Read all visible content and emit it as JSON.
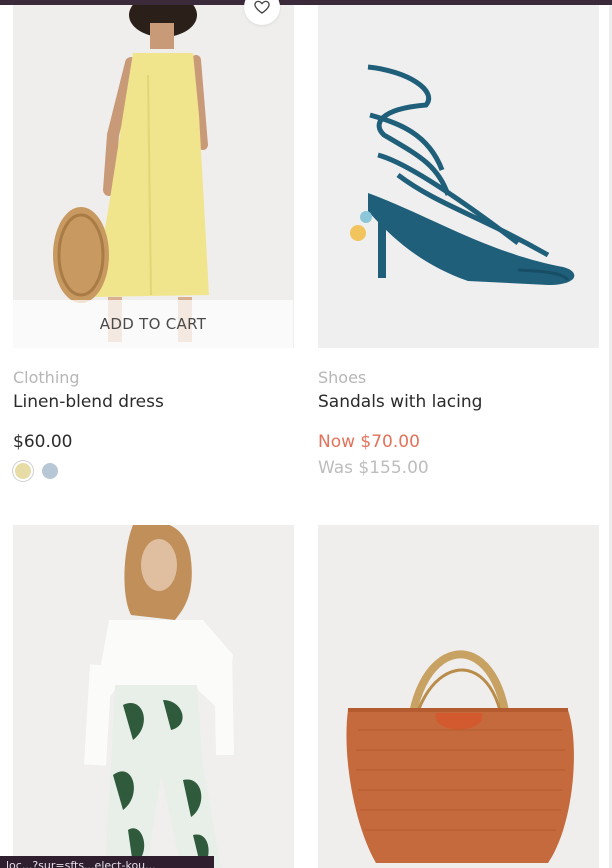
{
  "products": [
    {
      "category": "Clothing",
      "name": "Linen-blend dress",
      "price": "$60.00",
      "add_to_cart": "ADD TO CART",
      "swatches": [
        "#e8dca6",
        "#b7c7d6"
      ],
      "wishlist_icon": "heart-icon"
    },
    {
      "category": "Shoes",
      "name": "Sandals with lacing",
      "now_price": "Now $70.00",
      "was_price": "Was $155.00"
    }
  ],
  "colors": {
    "sale": "#e2725b",
    "topbar": "#3a2a3a"
  },
  "status_bar": {
    "text": "loc...?sur=sfts...elect-kou..."
  }
}
